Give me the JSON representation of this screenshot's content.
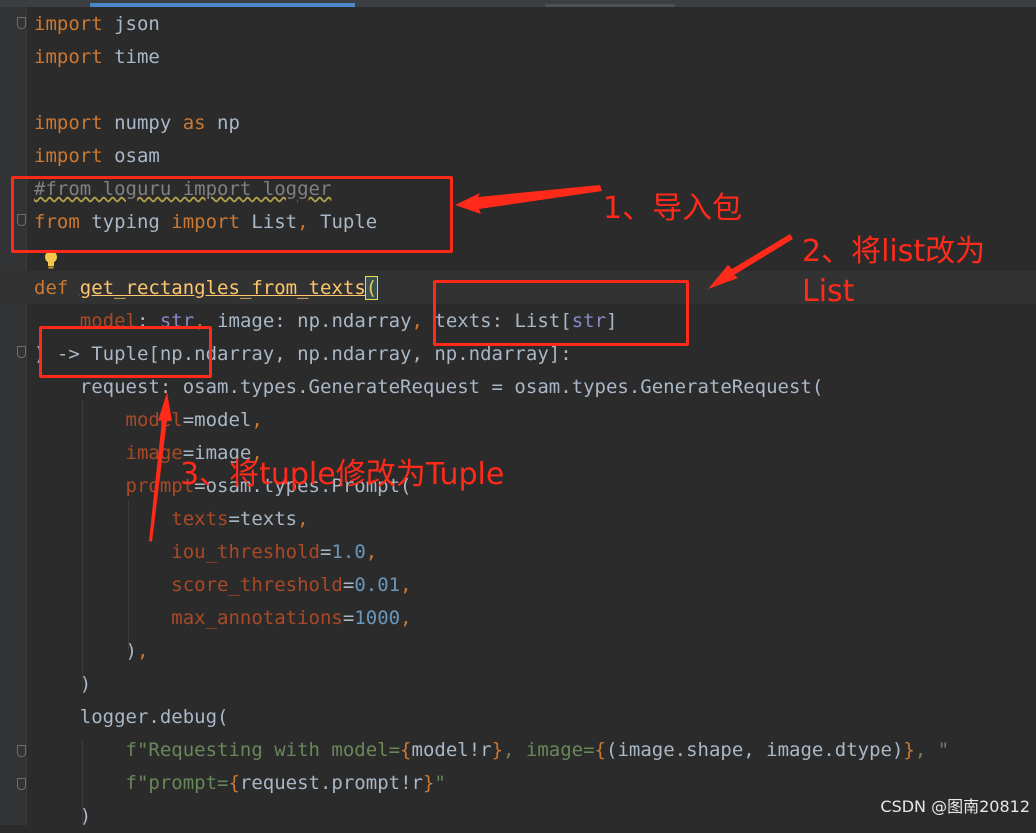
{
  "editor": {
    "lines": [
      [
        {
          "t": "import",
          "c": "kw"
        },
        {
          "t": " json"
        }
      ],
      [
        {
          "t": "import",
          "c": "kw"
        },
        {
          "t": " time"
        }
      ],
      [],
      [
        {
          "t": "import",
          "c": "kw"
        },
        {
          "t": " numpy "
        },
        {
          "t": "as",
          "c": "kw"
        },
        {
          "t": " np"
        }
      ],
      [
        {
          "t": "import",
          "c": "kw"
        },
        {
          "t": " osam"
        }
      ],
      [
        {
          "t": "#from loguru import logger",
          "c": "cm"
        }
      ],
      [
        {
          "t": "from",
          "c": "kw"
        },
        {
          "t": " typing "
        },
        {
          "t": "import",
          "c": "kw"
        },
        {
          "t": " List"
        },
        {
          "t": ", ",
          "c": "kw"
        },
        {
          "t": "Tuple"
        }
      ],
      [],
      [
        {
          "t": "def",
          "c": "kw"
        },
        {
          "t": " "
        },
        {
          "t": "get_rectangles_from_texts",
          "c": "fn"
        },
        {
          "t": "(",
          "c": "br"
        }
      ],
      [
        {
          "t": "    model",
          "c": "pa"
        },
        {
          "t": ": "
        },
        {
          "t": "str",
          "c": "bi"
        },
        {
          "t": ", ",
          "c": "kw"
        },
        {
          "t": "image: np.ndarray"
        },
        {
          "t": ", ",
          "c": "kw"
        },
        {
          "t": "texts: List["
        },
        {
          "t": "str",
          "c": "bi"
        },
        {
          "t": "]"
        }
      ],
      [
        {
          "t": ") -> Tuple[np.ndarray, np.ndarray, np.ndarray]:"
        }
      ],
      [
        {
          "t": "    request: osam.types.GenerateRequest = osam.types.GenerateRequest("
        }
      ],
      [
        {
          "t": "        model",
          "c": "pa"
        },
        {
          "t": "=model"
        },
        {
          "t": ",",
          "c": "kw"
        }
      ],
      [
        {
          "t": "        image",
          "c": "pa"
        },
        {
          "t": "=image"
        },
        {
          "t": ",",
          "c": "kw"
        }
      ],
      [
        {
          "t": "        prompt",
          "c": "pa"
        },
        {
          "t": "=osam.types.Prompt("
        }
      ],
      [
        {
          "t": "            texts",
          "c": "pa"
        },
        {
          "t": "=texts"
        },
        {
          "t": ",",
          "c": "kw"
        }
      ],
      [
        {
          "t": "            iou_threshold",
          "c": "pa"
        },
        {
          "t": "="
        },
        {
          "t": "1.0",
          "c": "nu"
        },
        {
          "t": ",",
          "c": "kw"
        }
      ],
      [
        {
          "t": "            score_threshold",
          "c": "pa"
        },
        {
          "t": "="
        },
        {
          "t": "0.01",
          "c": "nu"
        },
        {
          "t": ",",
          "c": "kw"
        }
      ],
      [
        {
          "t": "            max_annotations",
          "c": "pa"
        },
        {
          "t": "="
        },
        {
          "t": "1000",
          "c": "nu"
        },
        {
          "t": ",",
          "c": "kw"
        }
      ],
      [
        {
          "t": "        )"
        },
        {
          "t": ",",
          "c": "kw"
        }
      ],
      [
        {
          "t": "    )"
        }
      ],
      [
        {
          "t": "    logger.debug("
        }
      ],
      [
        {
          "t": "        f\"Requesting with model=",
          "c": "st"
        },
        {
          "t": "{",
          "c": "kw"
        },
        {
          "t": "model!r"
        },
        {
          "t": "}",
          "c": "kw"
        },
        {
          "t": ", image=",
          "c": "st"
        },
        {
          "t": "{",
          "c": "kw"
        },
        {
          "t": "(image.shape, image.dtype)"
        },
        {
          "t": "}",
          "c": "kw"
        },
        {
          "t": ", \"",
          "c": "st"
        }
      ],
      [
        {
          "t": "        f\"prompt=",
          "c": "st"
        },
        {
          "t": "{",
          "c": "kw"
        },
        {
          "t": "request.prompt!r"
        },
        {
          "t": "}",
          "c": "kw"
        },
        {
          "t": "\"",
          "c": "st"
        }
      ],
      [
        {
          "t": "    )"
        }
      ]
    ]
  },
  "annotations": {
    "step1": "1、导入包",
    "step2": "2、将list改为\nList",
    "step3": "3、将tuple修改为Tuple"
  },
  "watermark": "CSDN @图南20812",
  "colors": {
    "background": "#2b2b2b",
    "keyword": "#cc7832",
    "function": "#ffc66d",
    "number": "#6897bb",
    "string": "#6a8759",
    "annotation_red": "#ff2a1a"
  },
  "icons": {
    "intention_bulb": "lightbulb-icon",
    "fold_markers": "fold-marker-icon"
  }
}
